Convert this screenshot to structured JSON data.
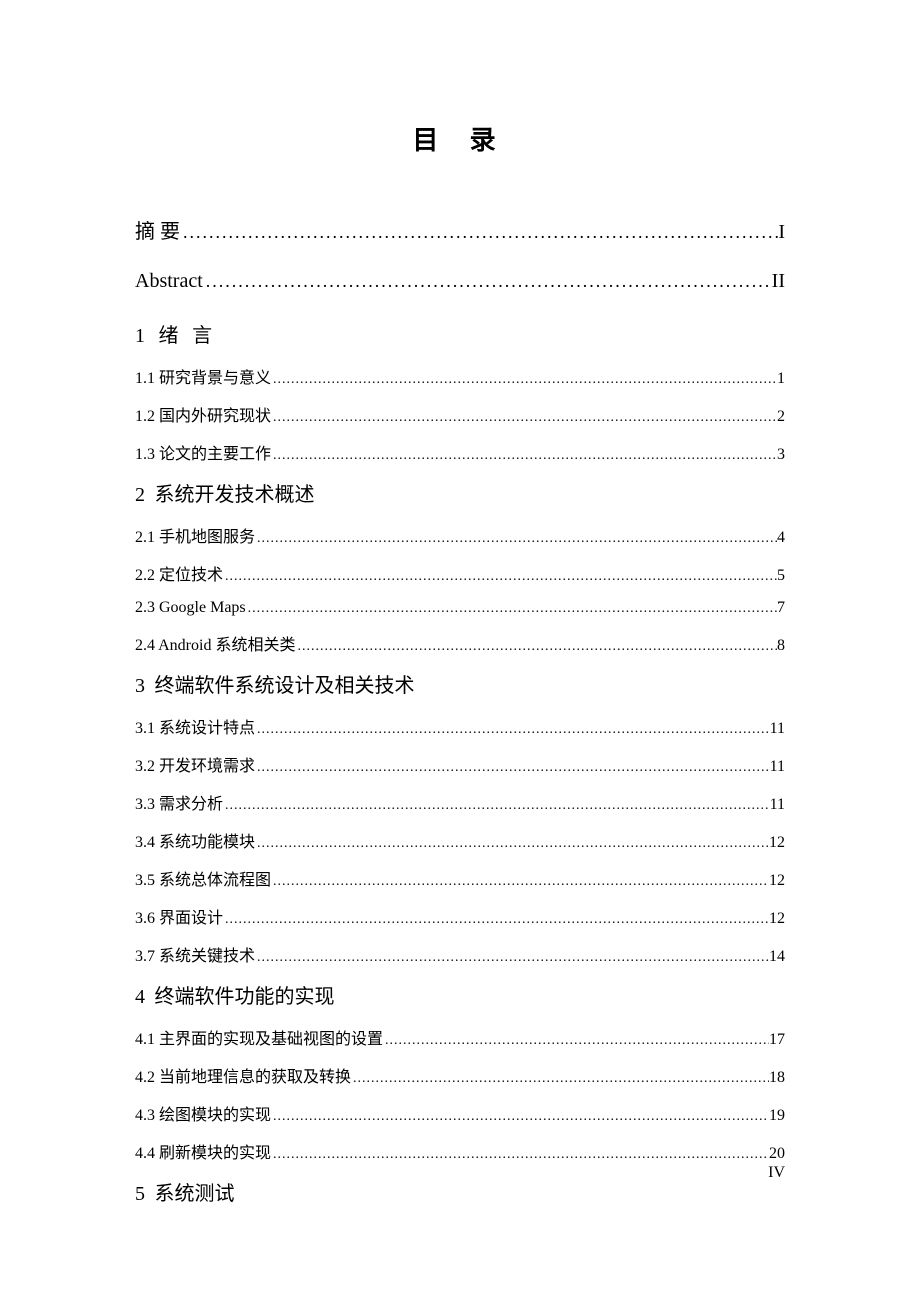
{
  "title": "目 录",
  "major_entries": [
    {
      "label": "摘   要",
      "page": "I",
      "spaced": false
    },
    {
      "label": "Abstract",
      "page": "II",
      "spaced": false
    }
  ],
  "sections": [
    {
      "num": "1",
      "title": "绪 言",
      "spaced": true,
      "items": [
        {
          "num": "1.1",
          "title": " 研究背景与意义",
          "page": "1"
        },
        {
          "num": "1.2",
          "title": " 国内外研究现状",
          "page": "2"
        },
        {
          "num": "1.3",
          "title": " 论文的主要工作",
          "page": "3"
        }
      ]
    },
    {
      "num": "2",
      "title": "系统开发技术概述",
      "spaced": false,
      "items": [
        {
          "num": "2.1",
          "title": " 手机地图服务",
          "page": "4"
        },
        {
          "num": "2.2",
          "title": " 定位技术",
          "page": "5"
        },
        {
          "num": "2.3",
          "title": " Google Maps",
          "page": "7"
        },
        {
          "num": "2.4",
          "title": " Android 系统相关类",
          "page": "8"
        }
      ]
    },
    {
      "num": "3",
      "title": "终端软件系统设计及相关技术",
      "spaced": false,
      "items": [
        {
          "num": "3.1",
          "title": " 系统设计特点",
          "page": "11"
        },
        {
          "num": "3.2",
          "title": " 开发环境需求",
          "page": "11"
        },
        {
          "num": "3.3",
          "title": " 需求分析",
          "page": "11"
        },
        {
          "num": "3.4",
          "title": " 系统功能模块",
          "page": "12"
        },
        {
          "num": "3.5",
          "title": " 系统总体流程图",
          "page": "12"
        },
        {
          "num": "3.6",
          "title": " 界面设计",
          "page": "12"
        },
        {
          "num": "3.7",
          "title": " 系统关键技术",
          "page": "14"
        }
      ]
    },
    {
      "num": "4",
      "title": "终端软件功能的实现",
      "spaced": false,
      "items": [
        {
          "num": "4.1",
          "title": " 主界面的实现及基础视图的设置",
          "page": "17"
        },
        {
          "num": "4.2",
          "title": "  当前地理信息的获取及转换",
          "page": "18"
        },
        {
          "num": "4.3",
          "title": "  绘图模块的实现",
          "page": "19"
        },
        {
          "num": "4.4",
          "title": "  刷新模块的实现",
          "page": "20"
        }
      ]
    },
    {
      "num": "5",
      "title": "系统测试",
      "spaced": false,
      "items": []
    }
  ],
  "footer_page": "IV",
  "dots": "........................................................................................................................................................................................"
}
